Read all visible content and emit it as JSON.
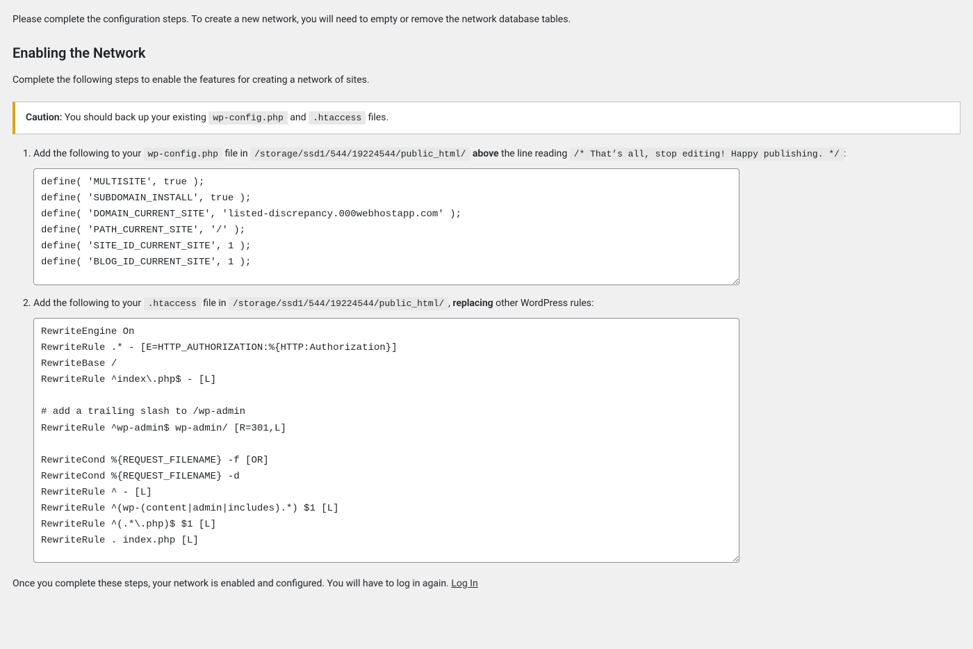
{
  "intro_top": "Please complete the configuration steps. To create a new network, you will need to empty or remove the network database tables.",
  "heading": "Enabling the Network",
  "intro_sub": "Complete the following steps to enable the features for creating a network of sites.",
  "caution": {
    "label": "Caution:",
    "before": " You should back up your existing ",
    "file1": "wp-config.php",
    "mid": " and ",
    "file2": ".htaccess",
    "after": " files."
  },
  "step1": {
    "t1": "Add the following to your ",
    "file": "wp-config.php",
    "t2": " file in ",
    "path": "/storage/ssd1/544/19224544/public_html/",
    "t3": " ",
    "bold": "above",
    "t4": " the line reading ",
    "comment": "/* That’s all, stop editing! Happy publishing. */",
    "t5": ":",
    "code": "define( 'MULTISITE', true );\ndefine( 'SUBDOMAIN_INSTALL', true );\ndefine( 'DOMAIN_CURRENT_SITE', 'listed-discrepancy.000webhostapp.com' );\ndefine( 'PATH_CURRENT_SITE', '/' );\ndefine( 'SITE_ID_CURRENT_SITE', 1 );\ndefine( 'BLOG_ID_CURRENT_SITE', 1 );"
  },
  "step2": {
    "t1": "Add the following to your ",
    "file": ".htaccess",
    "t2": " file in ",
    "path": "/storage/ssd1/544/19224544/public_html/",
    "t3": ", ",
    "bold": "replacing",
    "t4": " other WordPress rules:",
    "code": "RewriteEngine On\nRewriteRule .* - [E=HTTP_AUTHORIZATION:%{HTTP:Authorization}]\nRewriteBase /\nRewriteRule ^index\\.php$ - [L]\n\n# add a trailing slash to /wp-admin\nRewriteRule ^wp-admin$ wp-admin/ [R=301,L]\n\nRewriteCond %{REQUEST_FILENAME} -f [OR]\nRewriteCond %{REQUEST_FILENAME} -d\nRewriteRule ^ - [L]\nRewriteRule ^(wp-(content|admin|includes).*) $1 [L]\nRewriteRule ^(.*\\.php)$ $1 [L]\nRewriteRule . index.php [L]"
  },
  "final": {
    "text": "Once you complete these steps, your network is enabled and configured. You will have to log in again. ",
    "link": "Log In"
  }
}
